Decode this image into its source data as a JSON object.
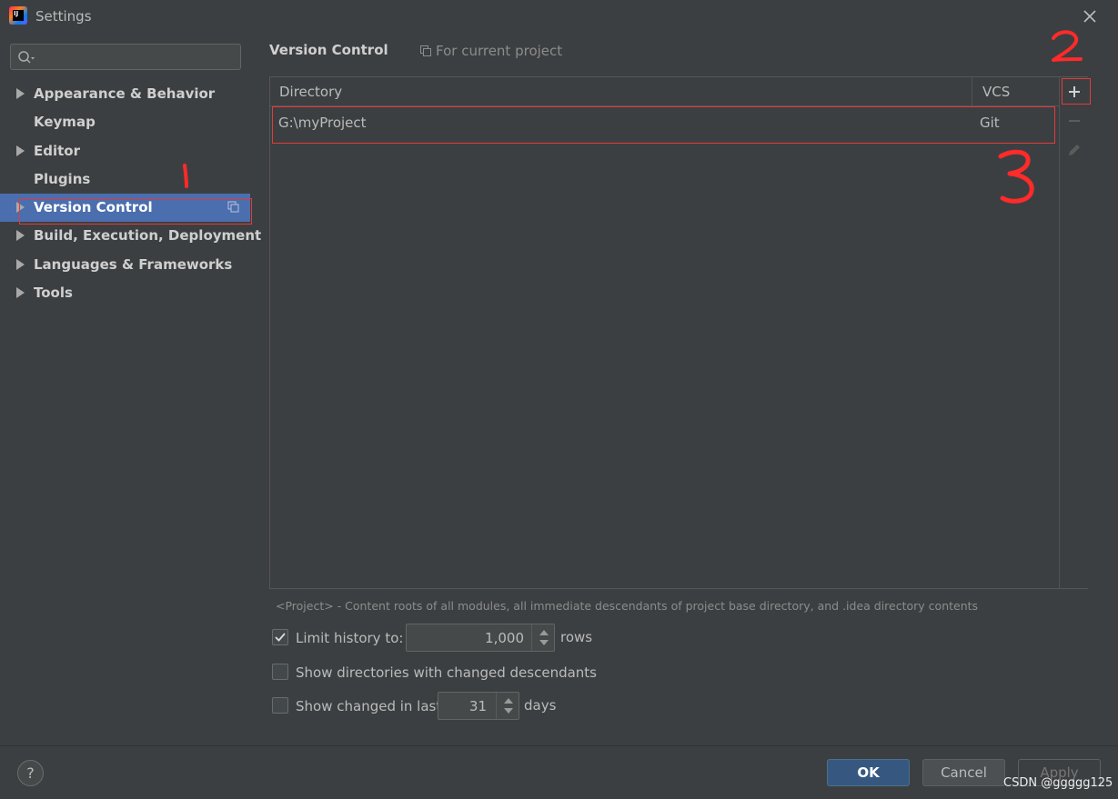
{
  "window": {
    "title": "Settings",
    "app_icon_text": "IJ"
  },
  "sidebar": {
    "search": {
      "placeholder": "",
      "value": ""
    },
    "items": [
      {
        "label": "Appearance & Behavior",
        "expandable": true,
        "selected": false
      },
      {
        "label": "Keymap",
        "expandable": false,
        "selected": false
      },
      {
        "label": "Editor",
        "expandable": true,
        "selected": false
      },
      {
        "label": "Plugins",
        "expandable": false,
        "selected": false
      },
      {
        "label": "Version Control",
        "expandable": true,
        "selected": true
      },
      {
        "label": "Build, Execution, Deployment",
        "expandable": true,
        "selected": false
      },
      {
        "label": "Languages & Frameworks",
        "expandable": true,
        "selected": false
      },
      {
        "label": "Tools",
        "expandable": true,
        "selected": false
      }
    ]
  },
  "main": {
    "title": "Version Control",
    "scope": "For current project",
    "table": {
      "columns": [
        "Directory",
        "VCS"
      ],
      "rows": [
        {
          "directory": "G:\\myProject",
          "vcs": "Git"
        }
      ]
    },
    "hint": "<Project> - Content roots of all modules, all immediate descendants of project base directory, and .idea directory contents",
    "options": {
      "limit_history": {
        "checked": true,
        "label": "Limit history to:",
        "value": "1,000",
        "suffix": "rows"
      },
      "show_directories": {
        "checked": false,
        "label": "Show directories with changed descendants"
      },
      "show_changed": {
        "checked": false,
        "label": "Show changed in last",
        "value": "31",
        "suffix": "days"
      }
    }
  },
  "footer": {
    "help_label": "?",
    "ok_label": "OK",
    "cancel_label": "Cancel",
    "apply_label": "Apply",
    "watermark": "CSDN @ggggg125"
  },
  "annotations": {
    "color": "#e03c3c"
  },
  "colors": {
    "background": "#3c3f41",
    "selection": "#4b6eaf",
    "ok_button": "#365880"
  }
}
